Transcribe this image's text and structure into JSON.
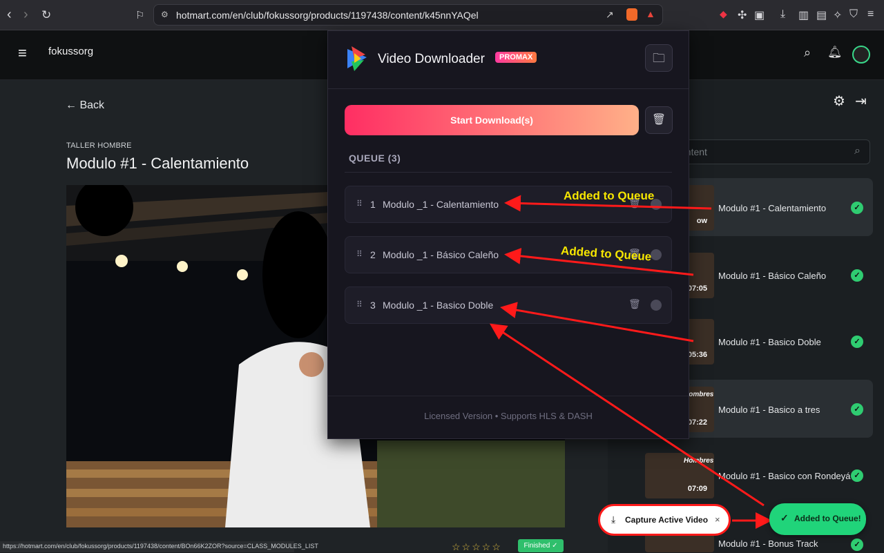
{
  "browser": {
    "url": "hotmart.com/en/club/fokussorg/products/1197438/content/k45nnYAQel",
    "status_url": "https://hotmart.com/en/club/fokussorg/products/1197438/content/BOn66K2ZOR?source=CLASS_MODULES_LIST"
  },
  "site": {
    "name": "fokussorg",
    "back_label": "Back",
    "breadcrumb": "TALLER HOMBRE",
    "lesson_title": "Modulo #1 - Calentamiento",
    "finished_label": "Finished",
    "rating_stars": "☆☆☆☆☆",
    "search_placeholder": "ontent"
  },
  "lessons": [
    {
      "title": "Modulo #1 - Calentamiento",
      "duration": "ow",
      "completed": true,
      "active": true
    },
    {
      "title": "Modulo #1 - Básico Caleño",
      "duration": "07:05",
      "completed": true,
      "active": false
    },
    {
      "title": "Modulo #1 - Basico Doble",
      "duration": "05:36",
      "completed": true,
      "active": false
    },
    {
      "title": "Modulo #1 - Basico a tres",
      "duration": "07:22",
      "completed": true,
      "active": true
    },
    {
      "title": "Modulo #1 - Basico con Rondeyá",
      "duration": "07:09",
      "completed": true,
      "active": false
    },
    {
      "title": "Modulo #1 - Bonus Track",
      "duration": "",
      "completed": true,
      "active": false
    }
  ],
  "thumb_text": "Hombres",
  "popup": {
    "app_title": "Video Downloader",
    "badge": "PROMAX",
    "start_label": "Start Download(s)",
    "queue_header": "QUEUE (3)",
    "queue": [
      {
        "index": "1",
        "name": "Modulo _1 - Calentamiento"
      },
      {
        "index": "2",
        "name": "Modulo _1 - Básico Caleño"
      },
      {
        "index": "3",
        "name": "Modulo _1 - Basico Doble"
      }
    ],
    "footer": "Licensed Version  •  Supports HLS & DASH"
  },
  "annotations": {
    "added1": "Added to Queue",
    "added2": "Added to Queue"
  },
  "capture": {
    "label": "Capture Active Video",
    "close": "×"
  },
  "toast": {
    "label": "Added to Queue!"
  },
  "colors": {
    "accent": "#ff2e63",
    "success": "#2fcc71",
    "annotation": "#f6e600",
    "arrow": "#ff1a1a"
  }
}
